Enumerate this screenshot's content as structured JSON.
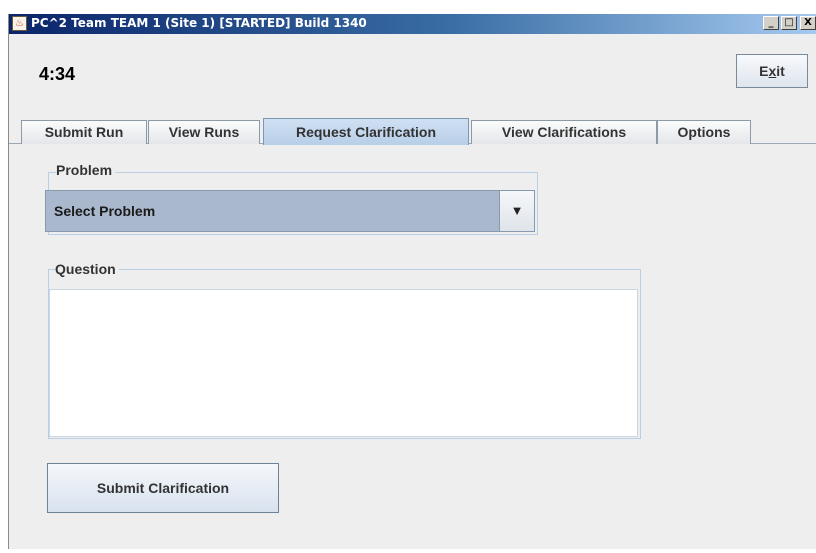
{
  "window": {
    "title": "PC^2 Team TEAM 1 (Site 1) [STARTED] Build 1340",
    "app_icon": "java-cup-icon",
    "minimize_glyph": "_",
    "maximize_glyph": "□",
    "close_glyph": "X"
  },
  "header": {
    "clock": "4:34",
    "exit_prefix": "E",
    "exit_mnemonic": "x",
    "exit_suffix": "it"
  },
  "tabs": [
    {
      "label": "Submit Run",
      "active": false
    },
    {
      "label": "View Runs",
      "active": false
    },
    {
      "label": "Request Clarification",
      "active": true
    },
    {
      "label": "View Clarifications",
      "active": false
    },
    {
      "label": "Options",
      "active": false
    }
  ],
  "form": {
    "problem_label": "Problem",
    "problem_selected": "Select Problem",
    "problem_arrow": "▼",
    "question_label": "Question",
    "question_value": "",
    "submit_label": "Submit Clarification"
  },
  "colors": {
    "titlebar_start": "#0a246a",
    "titlebar_end": "#a6caf0",
    "active_tab": "#b8cfe8",
    "combo_selected": "#a9b8cc"
  }
}
